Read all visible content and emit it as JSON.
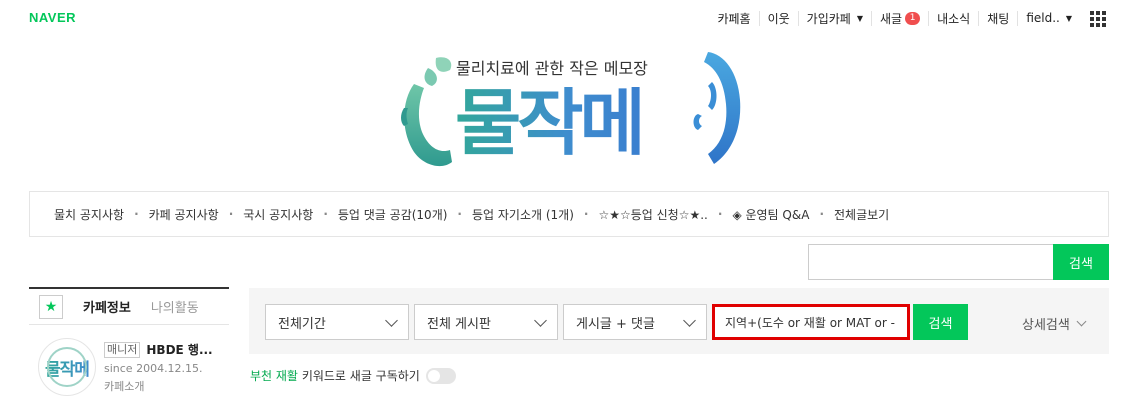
{
  "brand": {
    "logo_text": "NAVER",
    "accent": "#03c75a",
    "logo_color": "#03c75a"
  },
  "gnb": {
    "items": [
      {
        "label": "카페홈"
      },
      {
        "label": "이웃"
      },
      {
        "label": "가입카페"
      },
      {
        "label": "새글",
        "badge": "1"
      },
      {
        "label": "내소식"
      },
      {
        "label": "채팅"
      },
      {
        "label": "field.."
      }
    ],
    "apps_icon": "grid-icon"
  },
  "banner": {
    "slogan": "물리치료에 관한 작은 메모장",
    "title": "물작메"
  },
  "menu": {
    "items": [
      {
        "label": "물치 공지사항"
      },
      {
        "label": "카페 공지사항"
      },
      {
        "label": "국시 공지사항"
      },
      {
        "label": "등업 댓글 공감(10개)"
      },
      {
        "label": "등업 자기소개 (1개)"
      },
      {
        "label": "☆★☆등업 신청☆★.."
      },
      {
        "label": "◈ 운영팀 Q&A"
      },
      {
        "label": "전체글보기"
      }
    ]
  },
  "top_search": {
    "value": "",
    "button": "검색"
  },
  "sidebar": {
    "star_icon": "star-icon",
    "tabs": [
      {
        "label": "카페정보",
        "active": true
      },
      {
        "label": "나의활동",
        "active": false
      }
    ],
    "cafe": {
      "avatar_text": "물작메",
      "manager_tag": "매니저",
      "manager_name": "HBDE 행...",
      "since": "since 2004.12.15.",
      "intro": "카페소개"
    }
  },
  "search": {
    "period": "전체기간",
    "board": "전체 게시판",
    "scope": "게시글 + 댓글",
    "keyword": "지역+(도수 or 재활 or MAT or -",
    "button": "검색",
    "detail": "상세검색"
  },
  "subscribe": {
    "keywords": "부천 재활",
    "text": "키워드로 새글 구독하기",
    "enabled": false
  }
}
